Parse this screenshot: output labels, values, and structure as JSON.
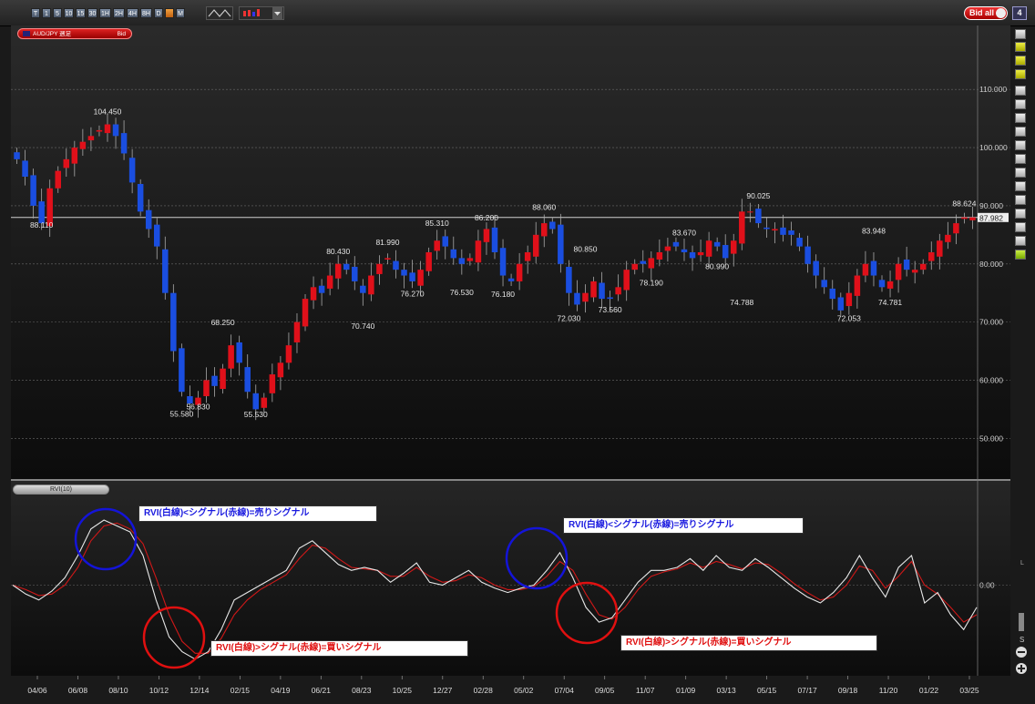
{
  "toolbar": {
    "timeframes": [
      "T",
      "1",
      "5",
      "10",
      "15",
      "30",
      "1H",
      "2H",
      "4H",
      "8H",
      "D",
      "",
      "M"
    ],
    "active_index": 11,
    "bid_all_label": "Bid all",
    "layout_count": "4"
  },
  "symbol": {
    "name": "AUD/JPY 週足",
    "side": "Bid"
  },
  "indicator_label": "RVI(10)",
  "callouts": {
    "sell": "RVI(白線)<シグナル(赤線)=売りシグナル",
    "buy": "RVI(白線)>シグナル(赤線)=買いシグナル"
  },
  "colors": {
    "up": "#e0101a",
    "down": "#1a4ee0",
    "rvi": "#e8e8e8",
    "signal": "#d01818",
    "bg_top": "#262626",
    "bg_bottom": "#0e0e0e"
  },
  "chart_data": [
    {
      "type": "candlestick",
      "ylim": [
        43,
        121
      ],
      "yticks": [
        "110.000",
        "100.000",
        "90.000",
        "80.000",
        "70.000",
        "60.000",
        "50.000"
      ],
      "ytick_values": [
        110,
        100,
        90,
        80,
        70,
        60,
        50
      ],
      "xticks": [
        "04/06",
        "06/08",
        "08/10",
        "10/12",
        "12/14",
        "02/15",
        "04/19",
        "06/21",
        "08/23",
        "10/25",
        "12/27",
        "02/28",
        "05/02",
        "07/04",
        "09/05",
        "11/07",
        "01/09",
        "03/13",
        "05/15",
        "07/17",
        "09/18",
        "11/20",
        "01/22",
        "03/25"
      ],
      "current_price": 87.982,
      "last_label": "88.624",
      "closes": [
        98,
        95,
        90,
        87,
        93,
        96,
        98,
        100,
        101,
        102,
        103,
        104,
        102,
        99,
        94,
        89,
        86,
        83,
        75,
        65,
        58,
        56,
        57,
        60,
        59,
        62,
        66,
        63,
        58,
        55,
        57,
        61,
        63,
        66,
        70,
        74,
        76,
        75,
        78,
        80,
        79,
        77,
        75,
        78,
        80,
        81,
        79,
        78,
        77,
        79,
        82,
        84,
        83,
        81,
        80,
        81,
        84,
        86,
        82,
        78,
        77,
        80,
        82,
        85,
        87,
        86,
        80,
        75,
        73,
        75,
        77,
        74,
        74,
        76,
        79,
        80,
        80,
        81,
        82,
        83,
        83,
        82,
        81,
        82,
        84,
        83,
        81,
        84,
        89,
        89,
        87,
        86,
        86,
        85,
        85,
        83,
        80,
        78,
        76,
        74,
        72,
        75,
        78,
        80,
        78,
        76,
        77,
        80,
        79,
        79,
        80,
        82,
        84,
        85,
        87,
        88,
        88
      ],
      "peaks": [
        {
          "label": "104.450",
          "i": 11,
          "v": 104.45,
          "pos": "above"
        },
        {
          "label": "88.110",
          "i": 3,
          "v": 88.11,
          "pos": "below"
        },
        {
          "label": "55.580",
          "i": 20,
          "v": 55.58,
          "pos": "below"
        },
        {
          "label": "56.830",
          "i": 22,
          "v": 56.83,
          "pos": "below"
        },
        {
          "label": "68.250",
          "i": 25,
          "v": 68.25,
          "pos": "above"
        },
        {
          "label": "55.530",
          "i": 29,
          "v": 55.53,
          "pos": "below"
        },
        {
          "label": "80.430",
          "i": 39,
          "v": 80.43,
          "pos": "above"
        },
        {
          "label": "70.740",
          "i": 42,
          "v": 70.74,
          "pos": "below"
        },
        {
          "label": "81.990",
          "i": 45,
          "v": 81.99,
          "pos": "above"
        },
        {
          "label": "76.270",
          "i": 48,
          "v": 76.27,
          "pos": "below"
        },
        {
          "label": "85.310",
          "i": 51,
          "v": 85.31,
          "pos": "above"
        },
        {
          "label": "76.530",
          "i": 54,
          "v": 76.53,
          "pos": "below"
        },
        {
          "label": "86.200",
          "i": 57,
          "v": 86.2,
          "pos": "above"
        },
        {
          "label": "76.180",
          "i": 59,
          "v": 76.18,
          "pos": "below"
        },
        {
          "label": "88.060",
          "i": 64,
          "v": 88.06,
          "pos": "above"
        },
        {
          "label": "72.030",
          "i": 67,
          "v": 72.03,
          "pos": "below"
        },
        {
          "label": "80.850",
          "i": 69,
          "v": 80.85,
          "pos": "above"
        },
        {
          "label": "73.560",
          "i": 72,
          "v": 73.56,
          "pos": "below"
        },
        {
          "label": "78.190",
          "i": 77,
          "v": 78.19,
          "pos": "below"
        },
        {
          "label": "83.670",
          "i": 81,
          "v": 83.67,
          "pos": "above"
        },
        {
          "label": "80.990",
          "i": 85,
          "v": 80.99,
          "pos": "below"
        },
        {
          "label": "74.788",
          "i": 88,
          "v": 74.788,
          "pos": "below"
        },
        {
          "label": "90.025",
          "i": 90,
          "v": 90.025,
          "pos": "above"
        },
        {
          "label": "83.948",
          "i": 104,
          "v": 83.948,
          "pos": "above"
        },
        {
          "label": "72.053",
          "i": 101,
          "v": 72.053,
          "pos": "below"
        },
        {
          "label": "74.781",
          "i": 106,
          "v": 74.781,
          "pos": "below"
        },
        {
          "label": "88.624",
          "i": 115,
          "v": 88.624,
          "pos": "above"
        }
      ]
    },
    {
      "type": "line",
      "name": "RVI(10)",
      "ylim": [
        -0.6,
        0.6
      ],
      "ytick_label": "0.00",
      "ytick_value": 0,
      "series": [
        {
          "values": [
            0.0,
            -0.06,
            -0.1,
            -0.04,
            0.05,
            0.2,
            0.38,
            0.44,
            0.4,
            0.36,
            0.2,
            -0.1,
            -0.35,
            -0.45,
            -0.5,
            -0.45,
            -0.3,
            -0.1,
            -0.05,
            0.0,
            0.05,
            0.1,
            0.25,
            0.3,
            0.22,
            0.14,
            0.1,
            0.12,
            0.1,
            0.02,
            0.08,
            0.15,
            0.02,
            0.0,
            0.05,
            0.1,
            0.02,
            -0.02,
            -0.05,
            -0.02,
            0.0,
            0.1,
            0.22,
            0.05,
            -0.15,
            -0.25,
            -0.22,
            -0.1,
            0.02,
            0.1,
            0.1,
            0.12,
            0.18,
            0.1,
            0.2,
            0.12,
            0.1,
            0.18,
            0.12,
            0.05,
            -0.02,
            -0.08,
            -0.12,
            -0.05,
            0.05,
            0.2,
            0.05,
            -0.08,
            0.12,
            0.2,
            -0.12,
            -0.05,
            -0.2,
            -0.3,
            -0.15
          ]
        },
        {
          "values": [
            0.0,
            -0.03,
            -0.07,
            -0.06,
            0.0,
            0.12,
            0.3,
            0.4,
            0.42,
            0.38,
            0.28,
            0.05,
            -0.2,
            -0.38,
            -0.46,
            -0.46,
            -0.36,
            -0.2,
            -0.1,
            -0.03,
            0.02,
            0.07,
            0.18,
            0.27,
            0.25,
            0.18,
            0.12,
            0.11,
            0.1,
            0.06,
            0.06,
            0.12,
            0.06,
            0.02,
            0.03,
            0.07,
            0.05,
            0.0,
            -0.03,
            -0.03,
            -0.01,
            0.06,
            0.16,
            0.1,
            -0.06,
            -0.2,
            -0.23,
            -0.15,
            -0.03,
            0.06,
            0.09,
            0.11,
            0.15,
            0.12,
            0.16,
            0.14,
            0.11,
            0.15,
            0.14,
            0.08,
            0.01,
            -0.05,
            -0.1,
            -0.08,
            0.0,
            0.13,
            0.1,
            -0.02,
            0.06,
            0.16,
            0.0,
            -0.06,
            -0.15,
            -0.25,
            -0.2
          ]
        }
      ]
    }
  ]
}
